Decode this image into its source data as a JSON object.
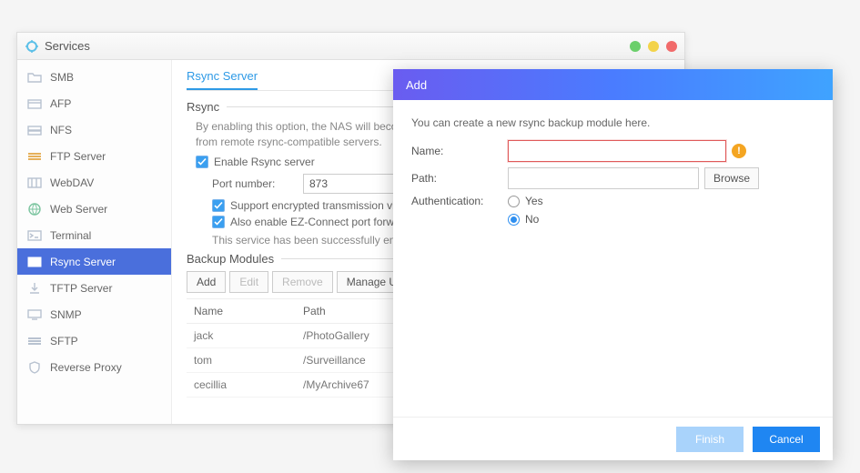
{
  "window": {
    "title": "Services"
  },
  "titlebar_dots": [
    "green",
    "yellow",
    "red"
  ],
  "sidebar": {
    "items": [
      {
        "label": "SMB",
        "icon": "folder"
      },
      {
        "label": "AFP",
        "icon": "folder-dash"
      },
      {
        "label": "NFS",
        "icon": "drive"
      },
      {
        "label": "FTP Server",
        "icon": "stack"
      },
      {
        "label": "WebDAV",
        "icon": "columns"
      },
      {
        "label": "Web Server",
        "icon": "globe"
      },
      {
        "label": "Terminal",
        "icon": "terminal"
      },
      {
        "label": "Rsync Server",
        "icon": "bars",
        "active": true
      },
      {
        "label": "TFTP Server",
        "icon": "download"
      },
      {
        "label": "SNMP",
        "icon": "monitor"
      },
      {
        "label": "SFTP",
        "icon": "lock-stack"
      },
      {
        "label": "Reverse Proxy",
        "icon": "shield"
      }
    ]
  },
  "main": {
    "tab": "Rsync Server",
    "section_rsync": "Rsync",
    "rsync_desc": "By enabling this option, the NAS will become a backup server and will be able to receive data from remote rsync-compatible servers.",
    "enable_label": "Enable Rsync server",
    "port_label": "Port number:",
    "port_value": "873",
    "ssh_label": "Support encrypted transmission via SSH",
    "ez_label": "Also enable EZ-Connect port forwarding",
    "status_note": "This service has been successfully enabled. You can now connect via the internal IP or DDNS.",
    "section_modules": "Backup Modules",
    "buttons": {
      "add": "Add",
      "edit": "Edit",
      "remove": "Remove",
      "manage": "Manage Users"
    },
    "cols": {
      "name": "Name",
      "path": "Path"
    },
    "rows": [
      {
        "name": "jack",
        "path": "/PhotoGallery"
      },
      {
        "name": "tom",
        "path": "/Surveillance"
      },
      {
        "name": "cecillia",
        "path": "/MyArchive67"
      }
    ]
  },
  "dialog": {
    "title": "Add",
    "desc": "You can create a new rsync backup module here.",
    "name_label": "Name:",
    "name_value": "",
    "path_label": "Path:",
    "path_value": "",
    "browse": "Browse",
    "auth_label": "Authentication:",
    "auth_options": [
      {
        "label": "Yes",
        "checked": false
      },
      {
        "label": "No",
        "checked": true
      }
    ],
    "finish": "Finish",
    "cancel": "Cancel"
  }
}
